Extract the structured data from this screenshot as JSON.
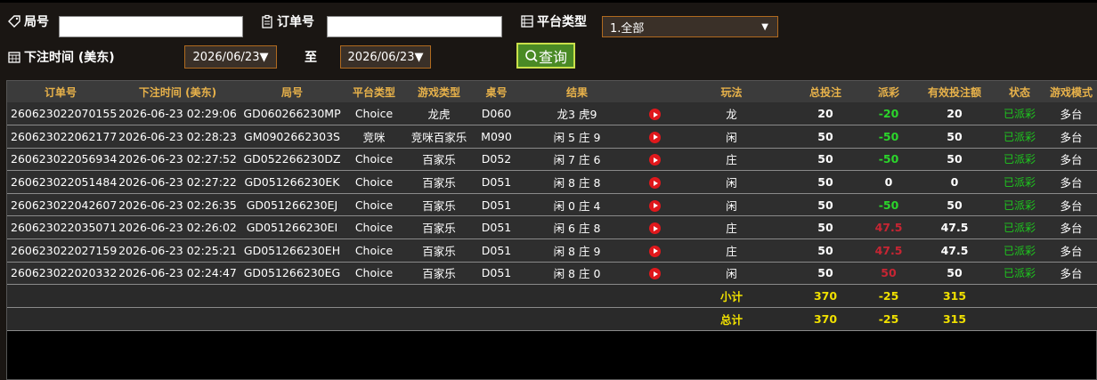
{
  "filters": {
    "round_label": "局号",
    "round_value": "",
    "order_label": "订单号",
    "order_value": "",
    "platform_label": "平台类型",
    "platform_selected": "1.全部",
    "time_label": "下注时间 (美东)",
    "date_from": "2026/06/23▼",
    "to_label": "至",
    "date_to": "2026/06/23▼",
    "query_label": "查询"
  },
  "table": {
    "headers": [
      "订单号",
      "下注时间 (美东)",
      "局号",
      "平台类型",
      "游戏类型",
      "桌号",
      "结果",
      "",
      "玩法",
      "总投注",
      "派彩",
      "有效投注额",
      "状态",
      "游戏模式"
    ],
    "rows": [
      {
        "order": "260623022070155",
        "time": "2026-06-23 02:29:06",
        "round": "GD060266230MP",
        "platform": "Choice",
        "game": "龙虎",
        "table": "D060",
        "result": "龙3 虎9",
        "play": "龙",
        "bet": "20",
        "payout": "-20",
        "payout_color": "green",
        "valid": "20",
        "status": "已派彩",
        "mode": "多台"
      },
      {
        "order": "260623022062177",
        "time": "2026-06-23 02:28:23",
        "round": "GM0902662303S",
        "platform": "竞咪",
        "game": "竞咪百家乐",
        "table": "M090",
        "result": "闲 5 庄 9",
        "play": "闲",
        "bet": "50",
        "payout": "-50",
        "payout_color": "green",
        "valid": "50",
        "status": "已派彩",
        "mode": "多台"
      },
      {
        "order": "260623022056934",
        "time": "2026-06-23 02:27:52",
        "round": "GD052266230DZ",
        "platform": "Choice",
        "game": "百家乐",
        "table": "D052",
        "result": "闲 7 庄 6",
        "play": "庄",
        "bet": "50",
        "payout": "-50",
        "payout_color": "green",
        "valid": "50",
        "status": "已派彩",
        "mode": "多台"
      },
      {
        "order": "260623022051484",
        "time": "2026-06-23 02:27:22",
        "round": "GD051266230EK",
        "platform": "Choice",
        "game": "百家乐",
        "table": "D051",
        "result": "闲 8 庄 8",
        "play": "闲",
        "bet": "50",
        "payout": "0",
        "payout_color": "white",
        "valid": "0",
        "status": "已派彩",
        "mode": "多台"
      },
      {
        "order": "260623022042607",
        "time": "2026-06-23 02:26:35",
        "round": "GD051266230EJ",
        "platform": "Choice",
        "game": "百家乐",
        "table": "D051",
        "result": "闲 0 庄 4",
        "play": "闲",
        "bet": "50",
        "payout": "-50",
        "payout_color": "green",
        "valid": "50",
        "status": "已派彩",
        "mode": "多台"
      },
      {
        "order": "260623022035071",
        "time": "2026-06-23 02:26:02",
        "round": "GD051266230EI",
        "platform": "Choice",
        "game": "百家乐",
        "table": "D051",
        "result": "闲 6 庄 8",
        "play": "庄",
        "bet": "50",
        "payout": "47.5",
        "payout_color": "red",
        "valid": "47.5",
        "status": "已派彩",
        "mode": "多台"
      },
      {
        "order": "260623022027159",
        "time": "2026-06-23 02:25:21",
        "round": "GD051266230EH",
        "platform": "Choice",
        "game": "百家乐",
        "table": "D051",
        "result": "闲 8 庄 9",
        "play": "庄",
        "bet": "50",
        "payout": "47.5",
        "payout_color": "red",
        "valid": "47.5",
        "status": "已派彩",
        "mode": "多台"
      },
      {
        "order": "260623022020332",
        "time": "2026-06-23 02:24:47",
        "round": "GD051266230EG",
        "platform": "Choice",
        "game": "百家乐",
        "table": "D051",
        "result": "闲 8 庄 0",
        "play": "闲",
        "bet": "50",
        "payout": "50",
        "payout_color": "red",
        "valid": "50",
        "status": "已派彩",
        "mode": "多台"
      }
    ],
    "subtotal": {
      "label": "小计",
      "bet": "370",
      "payout": "-25",
      "valid": "315"
    },
    "total": {
      "label": "总计",
      "bet": "370",
      "payout": "-25",
      "valid": "315"
    }
  },
  "colors": {
    "header_text": "#e8b24a",
    "payout_green": "#2bd52b",
    "payout_red": "#c72533",
    "status_green": "#1ec81e",
    "summary_yellow": "#f0e000"
  }
}
